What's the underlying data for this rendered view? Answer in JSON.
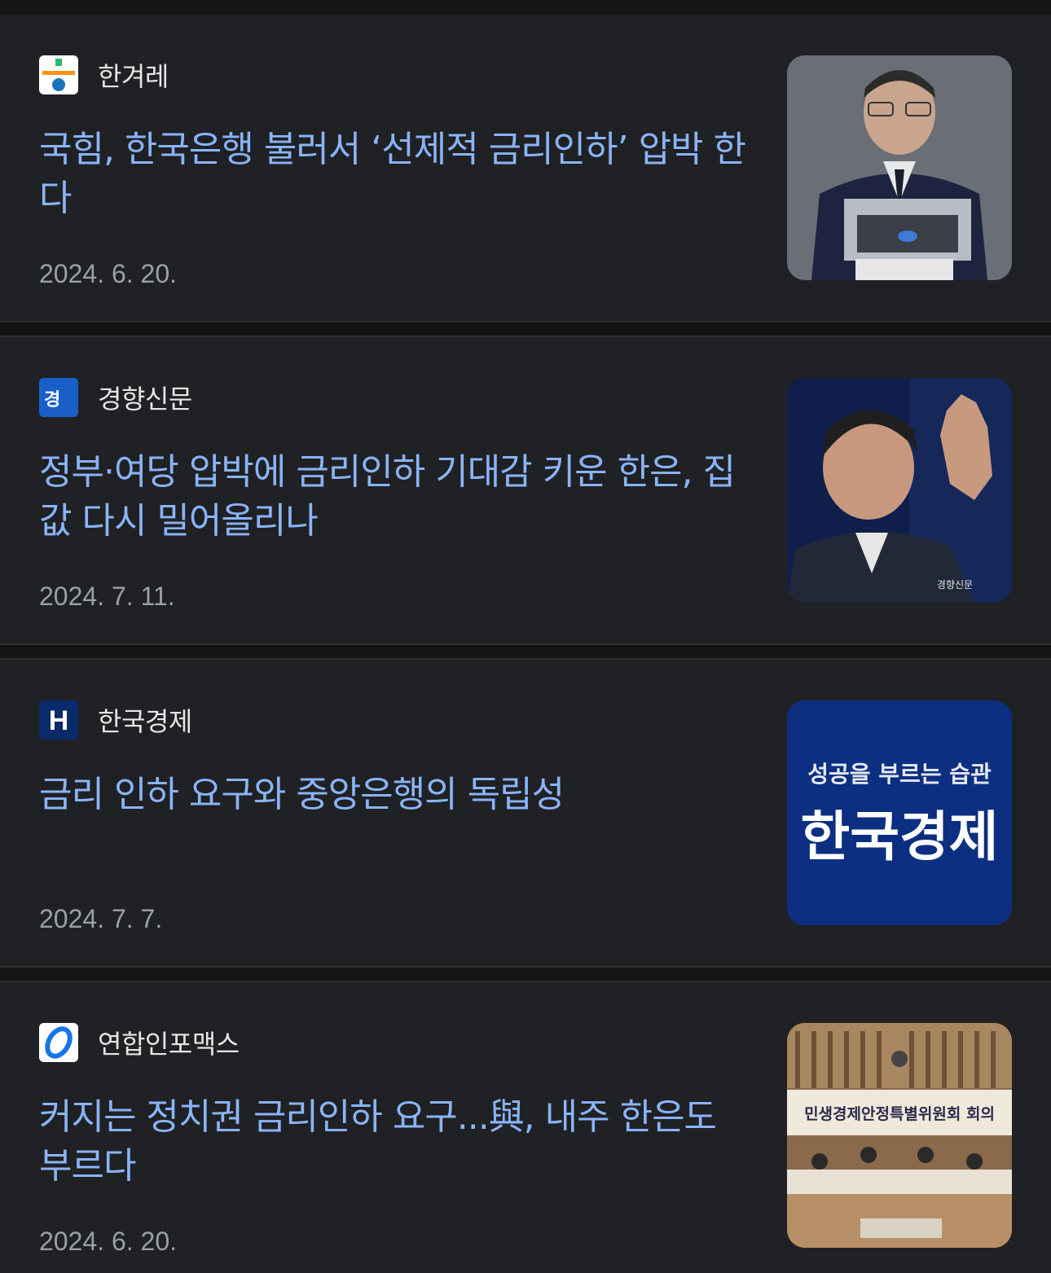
{
  "articles": [
    {
      "source": "한겨레",
      "headline": "국힘, 한국은행 불러서 ‘선제적 금리인하’ 압박 한다",
      "date": "2024. 6. 20."
    },
    {
      "source": "경향신문",
      "headline": "정부·여당 압박에 금리인하 기대감 키운 한은, 집값 다시 밀어올리나",
      "date": "2024. 7. 11.",
      "thumb_watermark": "경향신문"
    },
    {
      "source": "한국경제",
      "headline": "금리 인하 요구와 중앙은행의 독립성",
      "date": "2024. 7. 7.",
      "thumb_tagline": "성공을 부르는 습관",
      "thumb_brand": "한국경제"
    },
    {
      "source": "연합인포맥스",
      "headline": "커지는 정치권 금리인하 요구...與, 내주 한은도 부르다",
      "date": "2024. 6. 20.",
      "thumb_banner": "민생경제안정특별위원회 회의"
    }
  ],
  "colors": {
    "background": "#202124",
    "headline": "#8ab4f8",
    "date": "#9aa0a6",
    "source": "#e6e6e6"
  }
}
